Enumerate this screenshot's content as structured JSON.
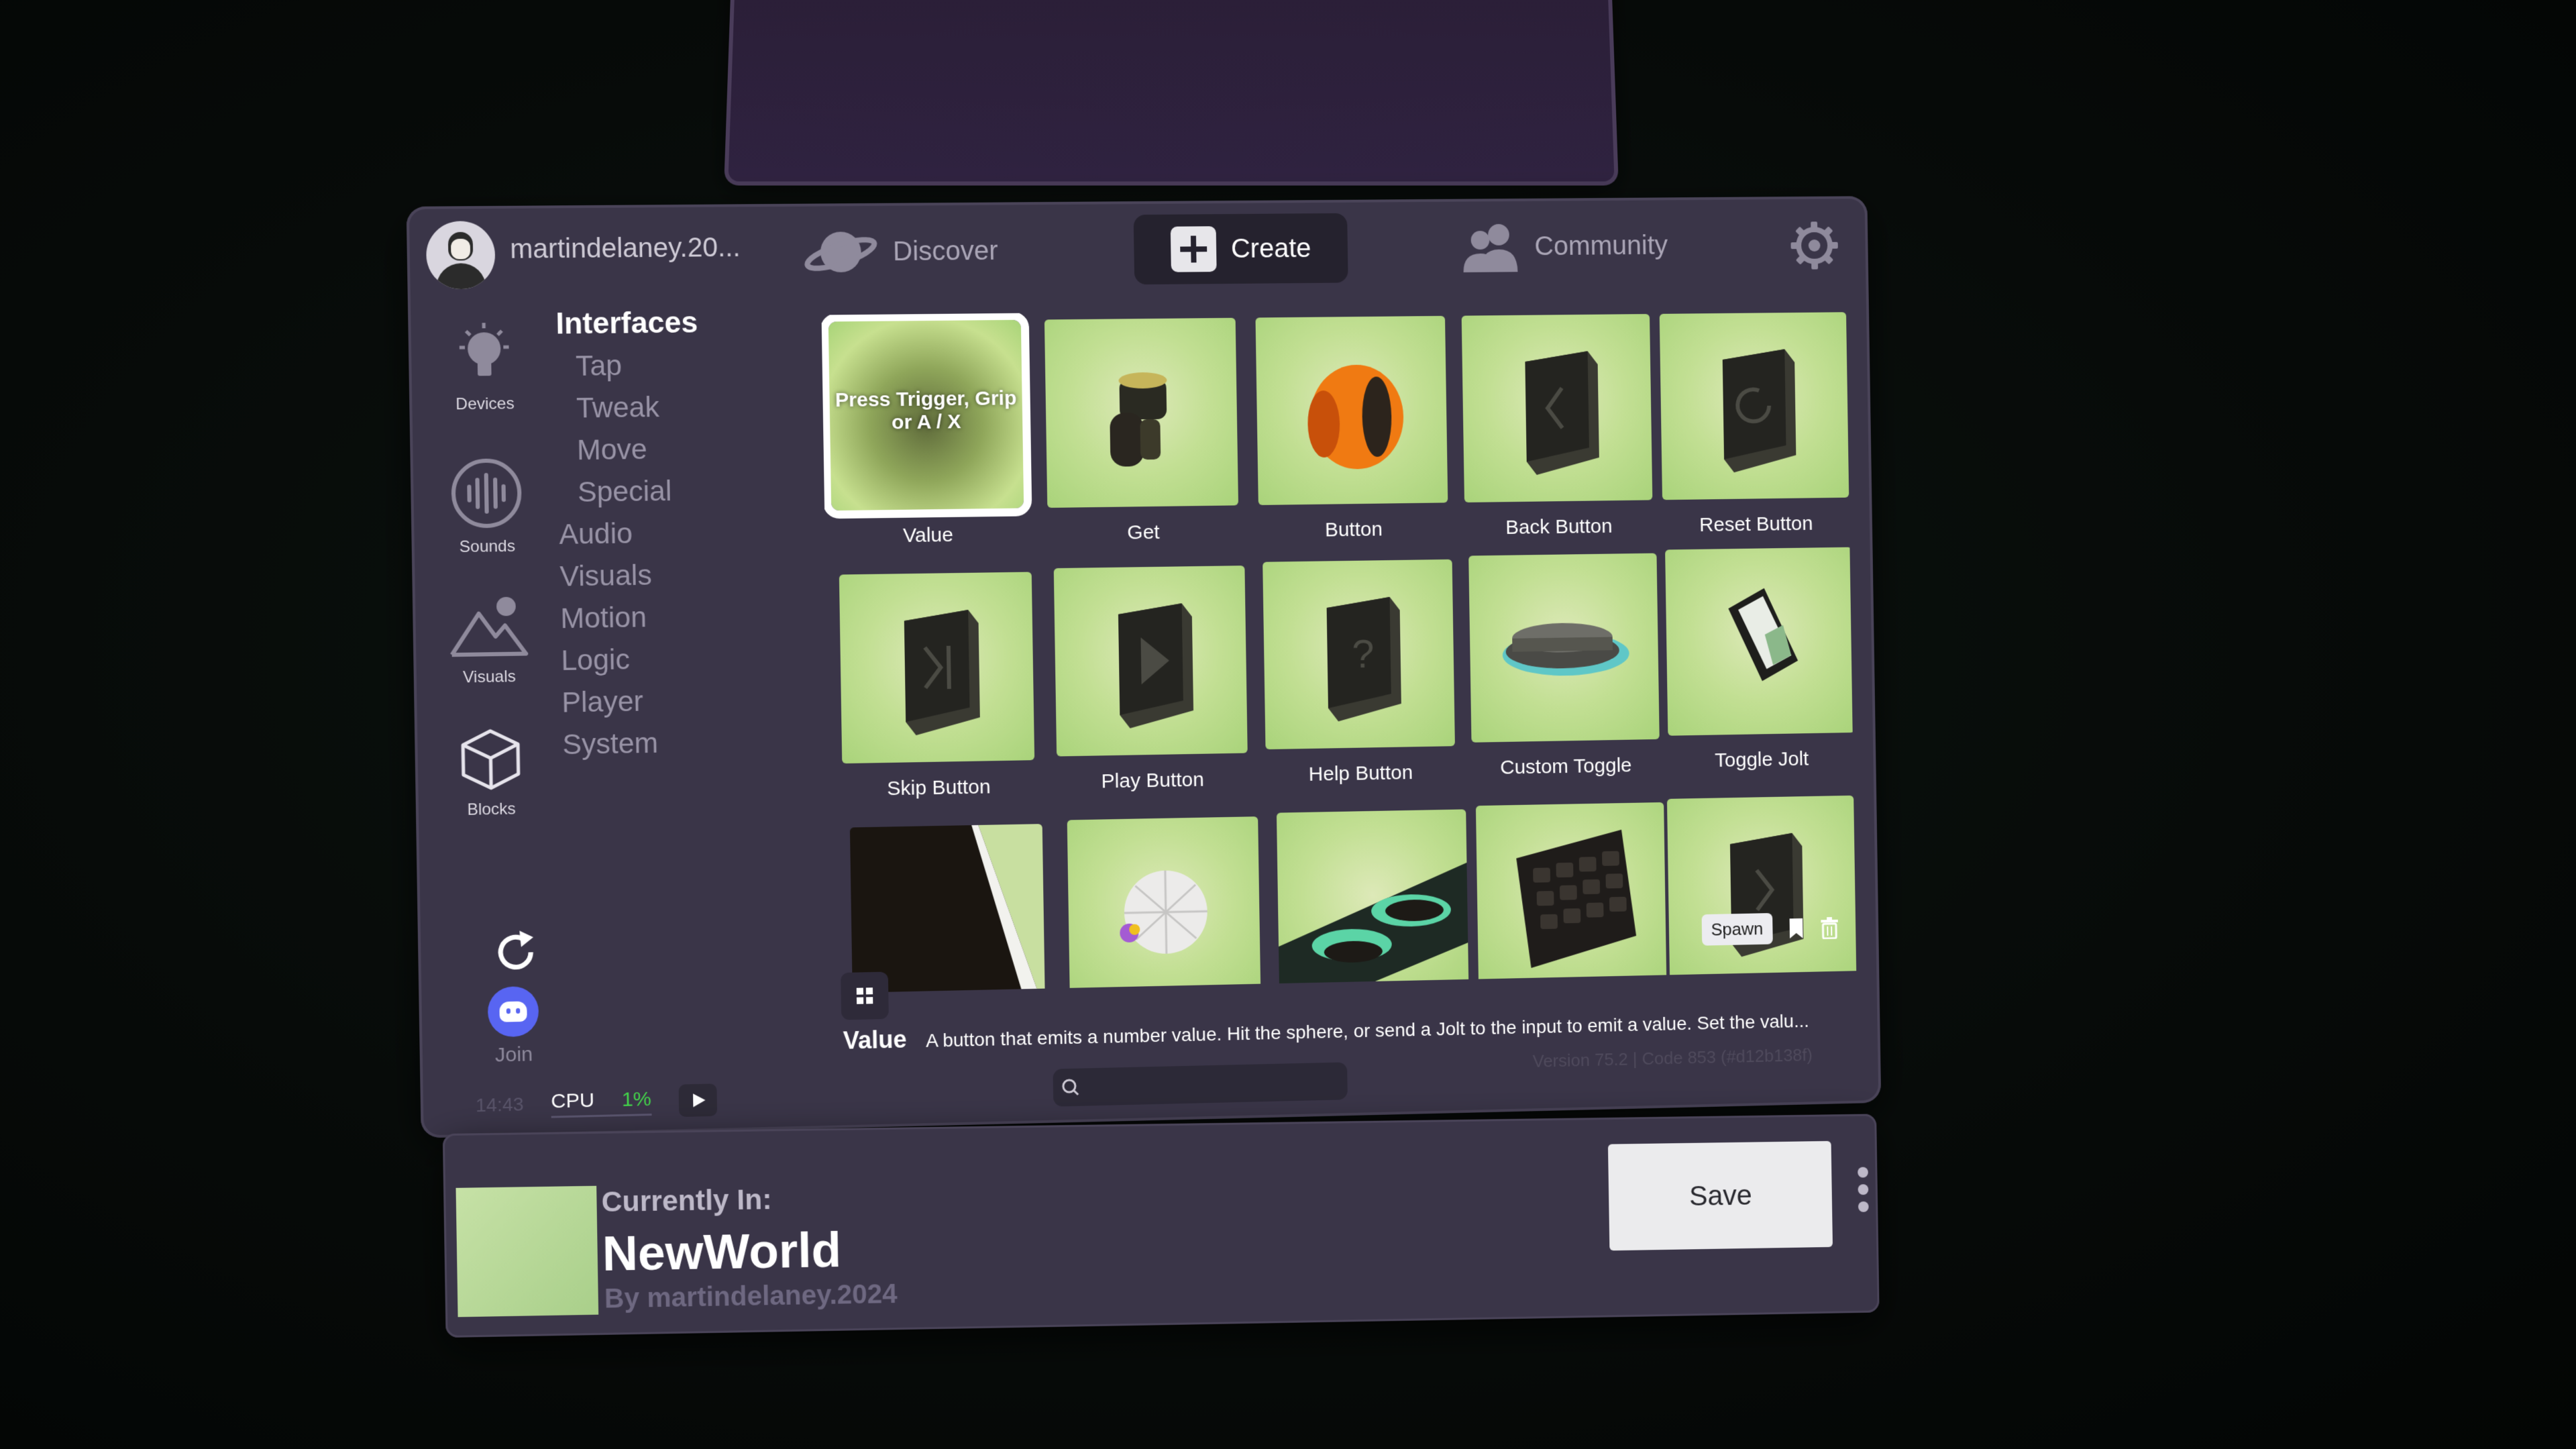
{
  "header": {
    "username": "martindelaney.20...",
    "nav": {
      "discover": "Discover",
      "create": "Create",
      "community": "Community"
    }
  },
  "sidebar": {
    "devices": "Devices",
    "sounds": "Sounds",
    "visuals": "Visuals",
    "blocks": "Blocks",
    "join": "Join"
  },
  "categories": {
    "title": "Interfaces",
    "subitems": [
      "Tap",
      "Tweak",
      "Move",
      "Special"
    ],
    "items": [
      "Audio",
      "Visuals",
      "Motion",
      "Logic",
      "Player",
      "System"
    ]
  },
  "grid": {
    "press_hint": "Press Trigger, Grip or A / X",
    "tiles": [
      {
        "label": "Value",
        "icon": "value-sphere-icon",
        "selected": true
      },
      {
        "label": "Get",
        "icon": "get-device-icon"
      },
      {
        "label": "Button",
        "icon": "orange-button-icon"
      },
      {
        "label": "Back Button",
        "icon": "back-button-icon"
      },
      {
        "label": "Reset Button",
        "icon": "reset-button-icon"
      },
      {
        "label": "Skip Button",
        "icon": "skip-button-icon"
      },
      {
        "label": "Play Button",
        "icon": "play-button-icon"
      },
      {
        "label": "Help Button",
        "icon": "help-button-icon"
      },
      {
        "label": "Custom Toggle",
        "icon": "custom-toggle-icon"
      },
      {
        "label": "Toggle Jolt",
        "icon": "toggle-jolt-icon"
      }
    ],
    "spawn": "Spawn"
  },
  "description": {
    "name": "Value",
    "text": "A button that emits a number value. Hit the sphere, or send a Jolt to the input to emit a value. Set the valu..."
  },
  "footer": {
    "time": "14:43",
    "cpu_label": "CPU",
    "cpu_value": "1%",
    "version": "Version 75.2 | Code 853 (#d12b138f)"
  },
  "world": {
    "currently_in": "Currently In:",
    "name": "NewWorld",
    "by": "By martindelaney.2024",
    "save": "Save"
  },
  "colors": {
    "panel": "#3a3548",
    "accent_green": "#43d34a",
    "discord": "#5865f2"
  }
}
